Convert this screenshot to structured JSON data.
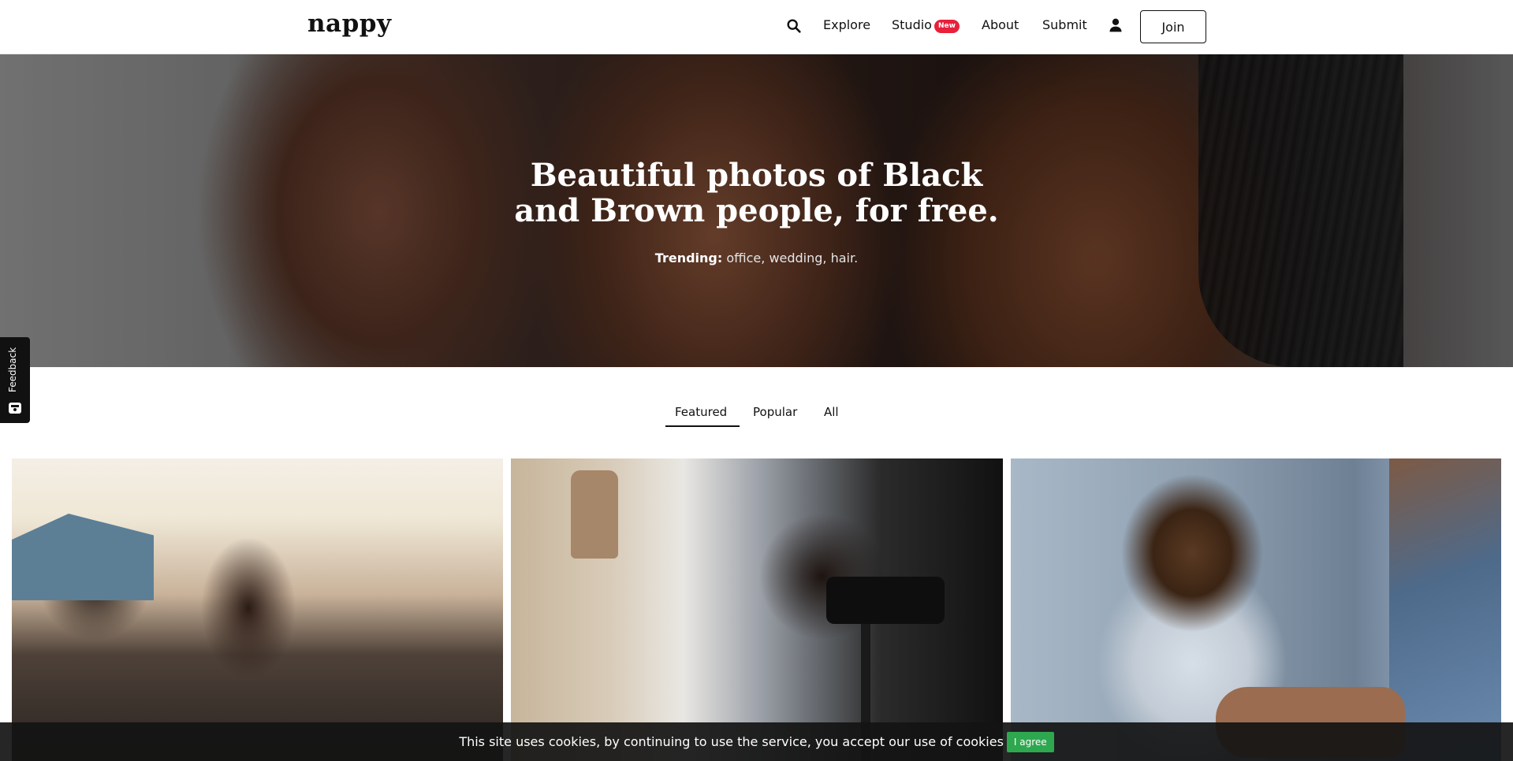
{
  "header": {
    "logo": "nappy",
    "nav": {
      "explore": "Explore",
      "studio": "Studio",
      "studio_badge": "New",
      "about": "About",
      "submit": "Submit",
      "join": "Join"
    }
  },
  "hero": {
    "title_line1": "Beautiful photos of Black",
    "title_line2": "and Brown people, for free.",
    "trending_label": "Trending:",
    "trending_items": [
      "office",
      "wedding",
      "hair"
    ],
    "trending_sep": ", ",
    "trending_end": "."
  },
  "feedback": {
    "label": "Feedback"
  },
  "tabs": {
    "items": [
      "Featured",
      "Popular",
      "All"
    ],
    "active": "Featured"
  },
  "cookie": {
    "text": "This site uses cookies, by continuing to use the service, you accept our use of cookies",
    "button": "I agree"
  },
  "colors": {
    "badge": "#e8203b",
    "cookie_button": "#2ea84f",
    "cookie_bar": "#141414"
  }
}
